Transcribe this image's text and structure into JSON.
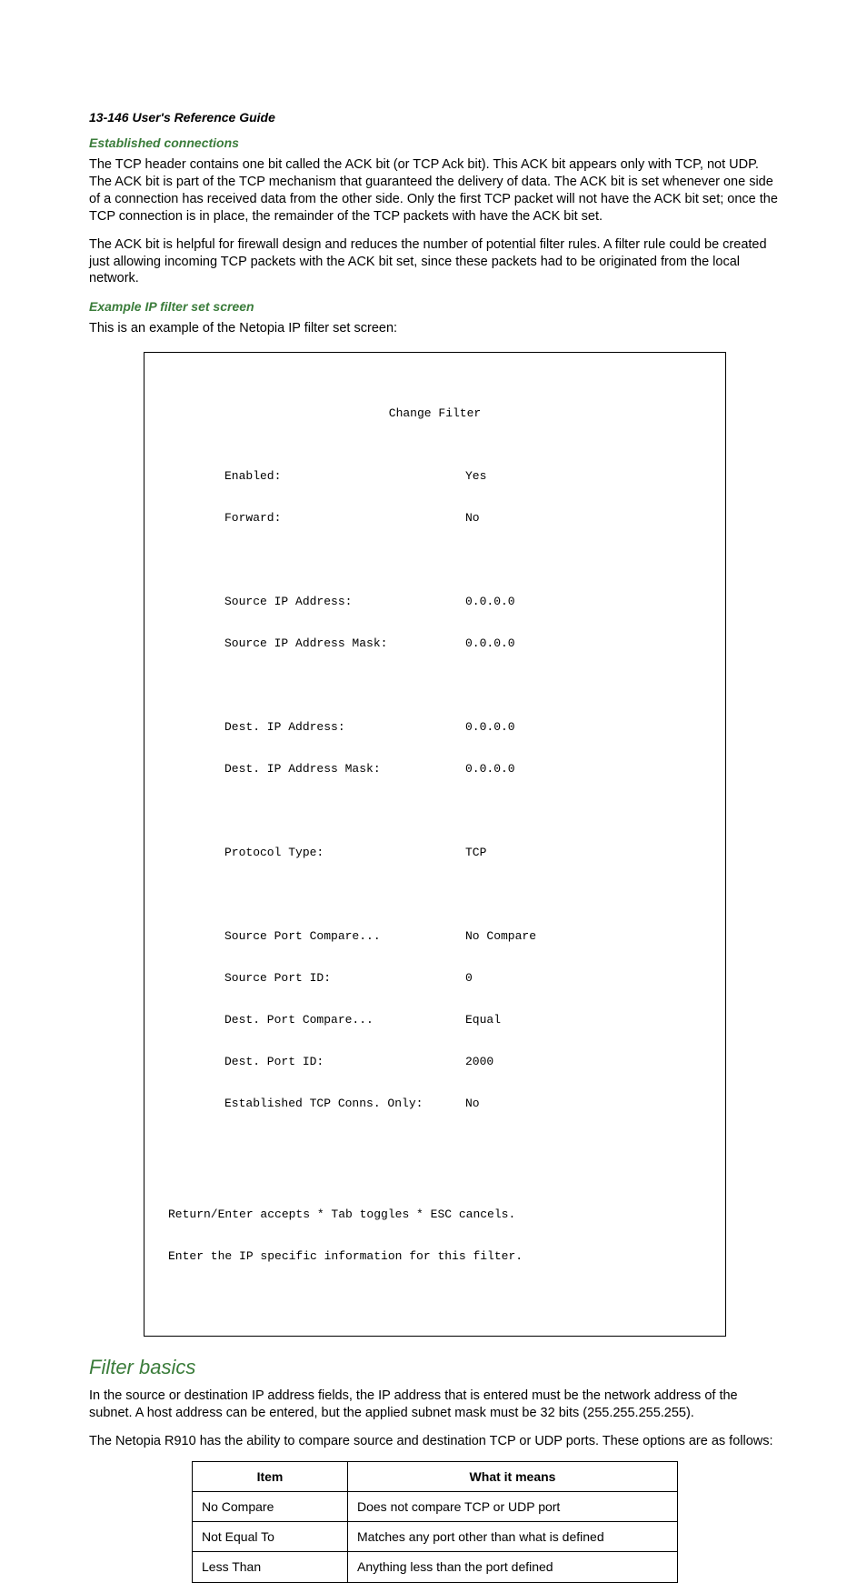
{
  "header": "13-146  User's Reference Guide",
  "sections": {
    "established": {
      "title": "Established connections",
      "p1": "The TCP header contains one bit called the ACK bit (or TCP Ack bit). This ACK bit appears only with TCP, not UDP. The ACK bit is part of the TCP mechanism that guaranteed the delivery of data. The ACK bit is set whenever one side of a connection has received data from the other side. Only the first TCP packet will not have the ACK bit set; once the TCP connection is in place, the remainder of the TCP packets with have the ACK bit set.",
      "p2": "The ACK bit is helpful for firewall design and reduces the number of potential filter rules. A filter rule could be created just allowing incoming TCP packets with the ACK bit set, since these packets had to be originated from the local network."
    },
    "example": {
      "title": "Example IP filter set screen",
      "intro": "This is an example of the Netopia IP filter set screen:",
      "terminal": {
        "title": "Change Filter",
        "groups": [
          [
            {
              "label": "Enabled:",
              "value": "Yes"
            },
            {
              "label": "Forward:",
              "value": "No"
            }
          ],
          [
            {
              "label": "Source IP Address:",
              "value": "0.0.0.0"
            },
            {
              "label": "Source IP Address Mask:",
              "value": "0.0.0.0"
            }
          ],
          [
            {
              "label": "Dest. IP Address:",
              "value": "0.0.0.0"
            },
            {
              "label": "Dest. IP Address Mask:",
              "value": "0.0.0.0"
            }
          ],
          [
            {
              "label": "Protocol Type:",
              "value": "TCP"
            }
          ],
          [
            {
              "label": "Source Port Compare...",
              "value": "No Compare"
            },
            {
              "label": "Source Port ID:",
              "value": "0"
            },
            {
              "label": "Dest. Port Compare...",
              "value": "Equal"
            },
            {
              "label": "Dest. Port ID:",
              "value": "2000"
            },
            {
              "label": "Established TCP Conns. Only:",
              "value": "No"
            }
          ]
        ],
        "footer1": "Return/Enter accepts * Tab toggles * ESC cancels.",
        "footer2": "Enter the IP specific information for this filter."
      }
    },
    "basics": {
      "title": "Filter basics",
      "p1": "In the source or destination IP address fields, the IP address that is entered must be the network address of the subnet. A host address can be entered, but the applied subnet mask must be 32 bits (255.255.255.255).",
      "p2": "The Netopia R910 has the ability to compare source and destination TCP or UDP ports. These options are as follows:",
      "table": {
        "headers": [
          "Item",
          "What it means"
        ],
        "rows": [
          [
            "No Compare",
            "Does not compare TCP or UDP port"
          ],
          [
            "Not Equal To",
            "Matches any port other than what is defined"
          ],
          [
            "Less Than",
            "Anything less than the port defined"
          ]
        ]
      }
    }
  }
}
